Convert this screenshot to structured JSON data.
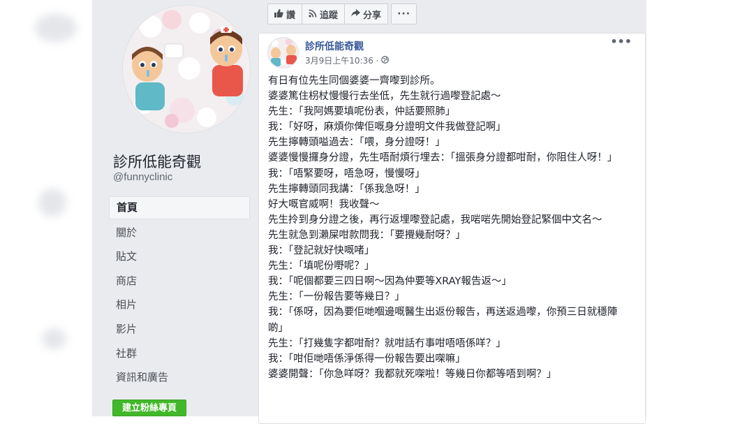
{
  "sidebar": {
    "page_name": "診所低能奇觀",
    "page_handle": "@funnyclinic",
    "nav_items": [
      {
        "label": "首頁",
        "active": true
      },
      {
        "label": "關於",
        "active": false
      },
      {
        "label": "貼文",
        "active": false
      },
      {
        "label": "商店",
        "active": false
      },
      {
        "label": "相片",
        "active": false
      },
      {
        "label": "影片",
        "active": false
      },
      {
        "label": "社群",
        "active": false
      },
      {
        "label": "資訊和廣告",
        "active": false
      }
    ],
    "create_page_label": "建立粉絲專頁"
  },
  "actions": {
    "like_label": "讚",
    "follow_label": "追蹤",
    "share_label": "分享",
    "more_label": "···"
  },
  "post": {
    "author": "診所低能奇觀",
    "timestamp": "3月9日上午10:36 ·",
    "options_label": "•••",
    "lines": [
      "有日有位先生同個婆婆一齊嚟到診所。",
      "婆婆篤住枴杖慢慢行去坐低，先生就行過嚟登記處～",
      "先生：「我阿媽要填呢份表，仲話要照肺」",
      "我：「好呀，麻煩你俾佢嘅身分證明文件我做登記啊」",
      "先生擰轉頭嗌過去：「喂，身分證呀！」",
      "婆婆慢慢攞身分證，先生唔耐煩行埋去：「搵張身分證都咁耐，你阻住人呀！」",
      "我：「唔緊要呀，唔急呀，慢慢呀」",
      "先生擰轉頭同我講：「係我急呀！」",
      "好大嘅官威啊！我收聲～",
      "先生拎到身分證之後，再行返埋嚟登記處，我啱啱先開始登記緊個中文名～",
      "先生就急到瀨屎咁款問我：「要攪幾耐呀？」",
      "我：「登記就好快嘅啫」",
      "先生：「填呢份嘢呢？」",
      "我：「呢個都要三四日啊～因為仲要等XRAY報告返～」",
      "先生：「一份報告要等幾日？」",
      "我：「係呀，因為要佢哋嗰邊嘅醫生出返份報告，再送返過嚟，你預三日就穩陣啲」",
      "先生：「打幾隻字都咁耐？就咁話冇事咁唔唔係咩？」",
      "我：「咁佢哋唔係淨係得一份報告要出㗎嘛」",
      "婆婆開聲：「你急咩呀？我都就死㗎啦！等幾日你都等唔到啊？」"
    ]
  },
  "colors": {
    "link_blue": "#365899",
    "button_green": "#42b72a",
    "page_bg": "#e9ebee"
  },
  "icons": [
    "like-icon",
    "rss-icon",
    "share-icon",
    "more-icon",
    "globe-icon",
    "post-options-icon"
  ]
}
